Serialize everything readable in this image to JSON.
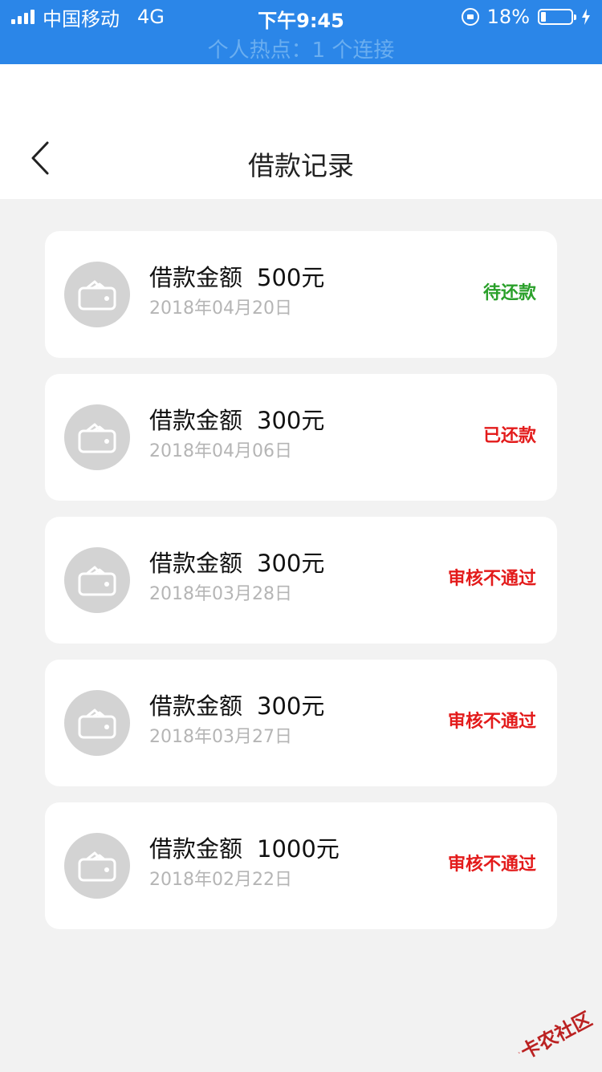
{
  "status_bar": {
    "carrier": "中国移动",
    "network": "4G",
    "time": "下午9:45",
    "battery": "18%",
    "battery_level": 0.18,
    "hotspot": "个人热点：1 个连接"
  },
  "nav": {
    "title": "借款记录",
    "back_icon": "chevron-left-icon"
  },
  "records": [
    {
      "label": "借款金额",
      "amount": "500元",
      "date": "2018年04月20日",
      "status": "待还款",
      "status_color": "#2aa02a"
    },
    {
      "label": "借款金额",
      "amount": "300元",
      "date": "2018年04月06日",
      "status": "已还款",
      "status_color": "#e31b1b"
    },
    {
      "label": "借款金额",
      "amount": "300元",
      "date": "2018年03月28日",
      "status": "审核不通过",
      "status_color": "#e31b1b"
    },
    {
      "label": "借款金额",
      "amount": "300元",
      "date": "2018年03月27日",
      "status": "审核不通过",
      "status_color": "#e31b1b"
    },
    {
      "label": "借款金额",
      "amount": "1000元",
      "date": "2018年02月22日",
      "status": "审核不通过",
      "status_color": "#e31b1b"
    }
  ],
  "record_icon": "wallet-icon",
  "watermark": {
    "text": "卡农社区"
  },
  "colors": {
    "status_bar_bg": "#2b86e8",
    "page_bg": "#f2f2f2",
    "icon_circle": "#d3d3d3"
  }
}
